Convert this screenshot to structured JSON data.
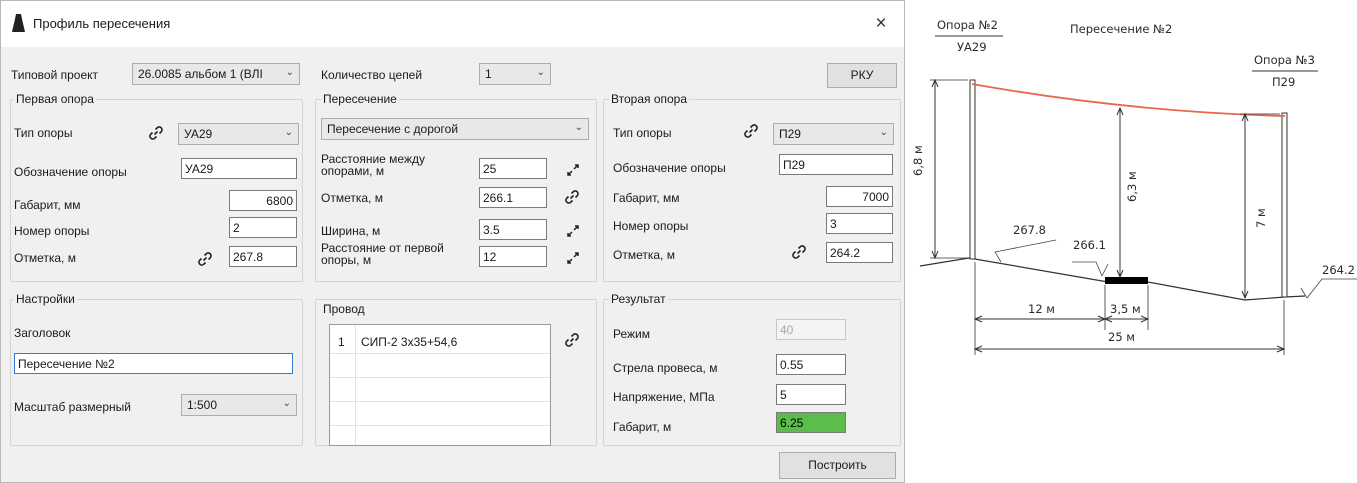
{
  "window": {
    "title": "Профиль пересечения",
    "close_symbol": "×"
  },
  "top": {
    "project_label": "Типовой проект",
    "project_value": "26.0085 альбом 1 (ВЛI",
    "circuits_label": "Количество цепей",
    "circuits_value": "1",
    "rku_button": "РКУ"
  },
  "first_support": {
    "title": "Первая опора",
    "type_label": "Тип опоры",
    "type_value": "УА29",
    "designation_label": "Обозначение опоры",
    "designation_value": "УА29",
    "clearance_label": "Габарит, мм",
    "clearance_value": "6800",
    "number_label": "Номер опоры",
    "number_value": "2",
    "elevation_label": "Отметка, м",
    "elevation_value": "267.8"
  },
  "crossing": {
    "title": "Пересечение",
    "type_value": "Пересечение с дорогой",
    "distance_label": "Расстояние между опорами, м",
    "distance_value": "25",
    "elevation_label": "Отметка, м",
    "elevation_value": "266.1",
    "width_label": "Ширина, м",
    "width_value": "3.5",
    "from_first_label": "Расстояние от первой опоры, м",
    "from_first_value": "12"
  },
  "second_support": {
    "title": "Вторая опора",
    "type_label": "Тип опоры",
    "type_value": "П29",
    "designation_label": "Обозначение опоры",
    "designation_value": "П29",
    "clearance_label": "Габарит, мм",
    "clearance_value": "7000",
    "number_label": "Номер опоры",
    "number_value": "3",
    "elevation_label": "Отметка, м",
    "elevation_value": "264.2"
  },
  "settings": {
    "title": "Настройки",
    "header_label": "Заголовок",
    "header_value": "Пересечение №2",
    "scale_label": "Масштаб размерный",
    "scale_value": "1:500"
  },
  "wire": {
    "title": "Провод",
    "rows": [
      {
        "index": "1",
        "name": "СИП-2 3х35+54,6"
      }
    ]
  },
  "result": {
    "title": "Результат",
    "mode_label": "Режим",
    "mode_value": "40",
    "sag_label": "Стрела провеса, м",
    "sag_value": "0.55",
    "stress_label": "Напряжение, МПа",
    "stress_value": "5",
    "clearance_label": "Габарит, м",
    "clearance_value": "6.25",
    "clearance_color": "#5bbd4a"
  },
  "build_button": "Построить",
  "drawing": {
    "support1_top": "Опора №2",
    "support1_bottom": "УА29",
    "title": "Пересечение №2",
    "support2_top": "Опора №3",
    "support2_bottom": "П29",
    "height_left": "6,8 м",
    "height_mid": "6,3 м",
    "height_right": "7 м",
    "elev_left": "267.8",
    "elev_mid": "266.1",
    "elev_right": "264.2",
    "dim_12": "12 м",
    "dim_35": "3,5 м",
    "dim_25": "25 м",
    "wire_color": "#e8674e"
  }
}
